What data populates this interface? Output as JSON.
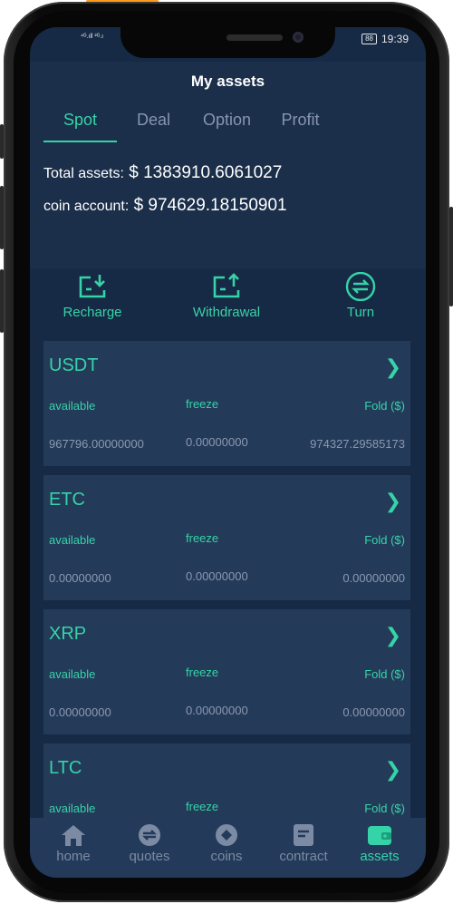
{
  "status_bar": {
    "signal_left": "⁴ᴳ.ıll ²ᴳ.ı",
    "battery": "88",
    "time": "19:39"
  },
  "header": {
    "title": "My assets"
  },
  "tabs": [
    {
      "label": "Spot"
    },
    {
      "label": "Deal"
    },
    {
      "label": "Option"
    },
    {
      "label": "Profit"
    }
  ],
  "summary": {
    "total_label": "Total assets:",
    "total_value": "$ 1383910.6061027",
    "coin_label": "coin account:",
    "coin_value": "$ 974629.18150901"
  },
  "actions": [
    {
      "label": "Recharge",
      "icon": "recharge-icon"
    },
    {
      "label": "Withdrawal",
      "icon": "withdrawal-icon"
    },
    {
      "label": "Turn",
      "icon": "transfer-icon"
    }
  ],
  "assets": [
    {
      "name": "USDT",
      "available_label": "available",
      "freeze_label": "freeze",
      "fold_label": "Fold ($)",
      "available": "967796.00000000",
      "freeze": "0.00000000",
      "fold": "974327.29585173"
    },
    {
      "name": "ETC",
      "available_label": "available",
      "freeze_label": "freeze",
      "fold_label": "Fold ($)",
      "available": "0.00000000",
      "freeze": "0.00000000",
      "fold": "0.00000000"
    },
    {
      "name": "XRP",
      "available_label": "available",
      "freeze_label": "freeze",
      "fold_label": "Fold ($)",
      "available": "0.00000000",
      "freeze": "0.00000000",
      "fold": "0.00000000"
    },
    {
      "name": "LTC",
      "available_label": "available",
      "freeze_label": "freeze",
      "fold_label": "Fold ($)",
      "available": "",
      "freeze": "",
      "fold": ""
    }
  ],
  "tabbar": [
    {
      "label": "home",
      "icon": "home-icon"
    },
    {
      "label": "quotes",
      "icon": "quotes-icon"
    },
    {
      "label": "coins",
      "icon": "coins-icon"
    },
    {
      "label": "contract",
      "icon": "contract-icon"
    },
    {
      "label": "assets",
      "icon": "wallet-icon"
    }
  ],
  "colors": {
    "accent": "#35d4a8",
    "background": "#172a45",
    "card": "#243a59",
    "muted": "#8a99b0"
  }
}
